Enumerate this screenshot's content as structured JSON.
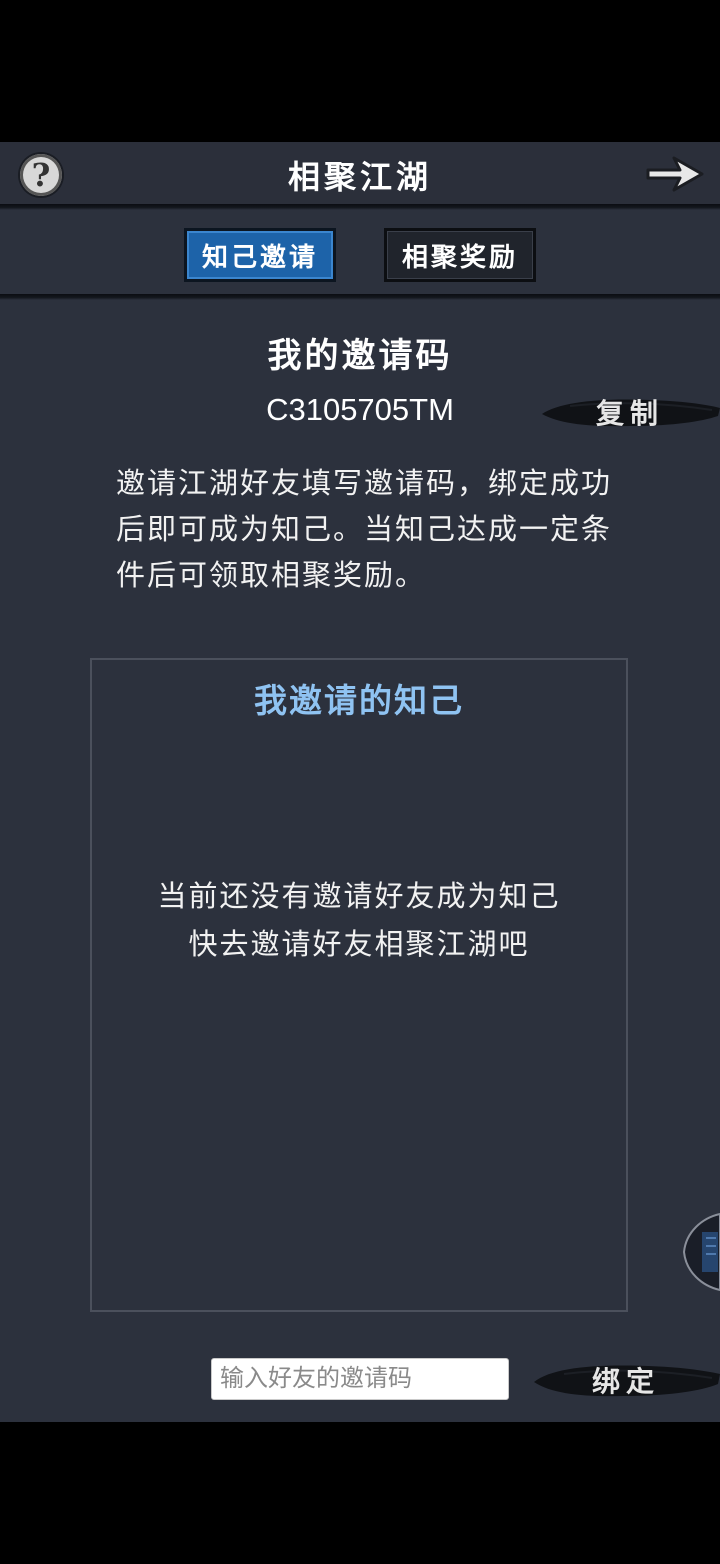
{
  "header": {
    "title": "相聚江湖",
    "help_icon": "question-mark-icon",
    "next_icon": "arrow-right-icon"
  },
  "tabs": [
    {
      "label": "知己邀请",
      "active": true
    },
    {
      "label": "相聚奖励",
      "active": false
    }
  ],
  "invite": {
    "heading": "我的邀请码",
    "code": "C3105705TM",
    "copy_label": "复制",
    "description": "邀请江湖好友填写邀请码，绑定成功后即可成为知己。当知己达成一定条件后可领取相聚奖励。"
  },
  "friends_panel": {
    "title": "我邀请的知己",
    "empty_line1": "当前还没有邀请好友成为知己",
    "empty_line2": "快去邀请好友相聚江湖吧"
  },
  "bind": {
    "input_value": "",
    "input_placeholder": "输入好友的邀请码",
    "button_label": "绑定"
  },
  "colors": {
    "background": "#2c313d",
    "active_tab": "#1d63a9",
    "panel_title": "#8fc3f2"
  }
}
